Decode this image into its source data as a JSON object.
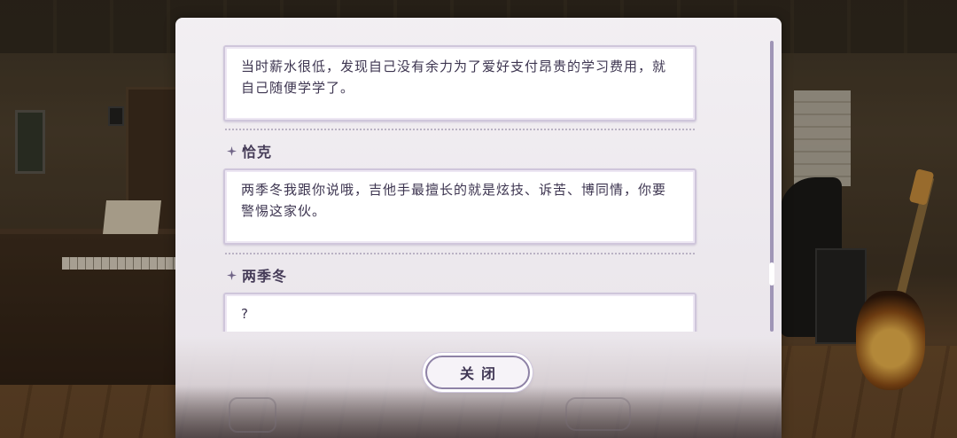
{
  "dialog_log": {
    "entries": [
      {
        "speaker": "",
        "text": "当时薪水很低，发现自己没有余力为了爱好支付昂贵的学习费用，就自己随便学学了。"
      },
      {
        "speaker": "恰克",
        "text": "两季冬我跟你说哦，吉他手最擅长的就是炫技、诉苦、博同情，你要警惕这家伙。"
      },
      {
        "speaker": "两季冬",
        "text": "?"
      }
    ],
    "scroll_position": 0.85
  },
  "buttons": {
    "close_label": "关闭"
  },
  "icons": {
    "speaker_marker": "sparkle-icon"
  },
  "colors": {
    "panel_bg": "#f6f3f7",
    "text": "#3d3550",
    "accent": "#8e82a6",
    "scrollbar": "#9f95b6"
  }
}
